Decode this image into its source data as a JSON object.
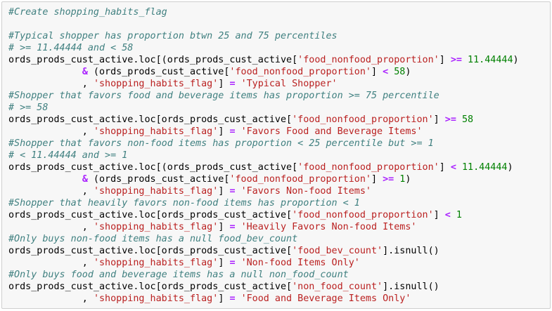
{
  "cell": {
    "language": "python",
    "lines": [
      [
        {
          "t": "com",
          "v": "#Create shopping_habits_flag"
        }
      ],
      [],
      [
        {
          "t": "com",
          "v": "#Typical shopper has proportion btwn 25 and 75 percentiles"
        }
      ],
      [
        {
          "t": "com",
          "v": "# >= 11.44444 and < 58"
        }
      ],
      [
        {
          "t": "p",
          "v": "ords_prods_cust_active.loc[(ords_prods_cust_active["
        },
        {
          "t": "str",
          "v": "'food_nonfood_proportion'"
        },
        {
          "t": "p",
          "v": "] "
        },
        {
          "t": "op",
          "v": ">="
        },
        {
          "t": "p",
          "v": " "
        },
        {
          "t": "num",
          "v": "11.44444"
        },
        {
          "t": "p",
          "v": ")"
        }
      ],
      [
        {
          "t": "p",
          "v": "             "
        },
        {
          "t": "op",
          "v": "&"
        },
        {
          "t": "p",
          "v": " (ords_prods_cust_active["
        },
        {
          "t": "str",
          "v": "'food_nonfood_proportion'"
        },
        {
          "t": "p",
          "v": "] "
        },
        {
          "t": "op",
          "v": "<"
        },
        {
          "t": "p",
          "v": " "
        },
        {
          "t": "num",
          "v": "58"
        },
        {
          "t": "p",
          "v": ")"
        }
      ],
      [
        {
          "t": "p",
          "v": "             , "
        },
        {
          "t": "str",
          "v": "'shopping_habits_flag'"
        },
        {
          "t": "p",
          "v": "] "
        },
        {
          "t": "op",
          "v": "="
        },
        {
          "t": "p",
          "v": " "
        },
        {
          "t": "str",
          "v": "'Typical Shopper'"
        }
      ],
      [
        {
          "t": "com",
          "v": "#Shopper that favors food and beverage items has proportion >= 75 percentile"
        }
      ],
      [
        {
          "t": "com",
          "v": "# >= 58"
        }
      ],
      [
        {
          "t": "p",
          "v": "ords_prods_cust_active.loc[ords_prods_cust_active["
        },
        {
          "t": "str",
          "v": "'food_nonfood_proportion'"
        },
        {
          "t": "p",
          "v": "] "
        },
        {
          "t": "op",
          "v": ">="
        },
        {
          "t": "p",
          "v": " "
        },
        {
          "t": "num",
          "v": "58"
        }
      ],
      [
        {
          "t": "p",
          "v": "             , "
        },
        {
          "t": "str",
          "v": "'shopping_habits_flag'"
        },
        {
          "t": "p",
          "v": "] "
        },
        {
          "t": "op",
          "v": "="
        },
        {
          "t": "p",
          "v": " "
        },
        {
          "t": "str",
          "v": "'Favors Food and Beverage Items'"
        }
      ],
      [
        {
          "t": "com",
          "v": "#Shopper that favors non-food items has proportion < 25 percentile but >= 1"
        }
      ],
      [
        {
          "t": "com",
          "v": "# < 11.44444 and >= 1"
        }
      ],
      [
        {
          "t": "p",
          "v": "ords_prods_cust_active.loc[(ords_prods_cust_active["
        },
        {
          "t": "str",
          "v": "'food_nonfood_proportion'"
        },
        {
          "t": "p",
          "v": "] "
        },
        {
          "t": "op",
          "v": "<"
        },
        {
          "t": "p",
          "v": " "
        },
        {
          "t": "num",
          "v": "11.44444"
        },
        {
          "t": "p",
          "v": ")"
        }
      ],
      [
        {
          "t": "p",
          "v": "             "
        },
        {
          "t": "op",
          "v": "&"
        },
        {
          "t": "p",
          "v": " (ords_prods_cust_active["
        },
        {
          "t": "str",
          "v": "'food_nonfood_proportion'"
        },
        {
          "t": "p",
          "v": "] "
        },
        {
          "t": "op",
          "v": ">="
        },
        {
          "t": "p",
          "v": " "
        },
        {
          "t": "num",
          "v": "1"
        },
        {
          "t": "p",
          "v": ")"
        }
      ],
      [
        {
          "t": "p",
          "v": "             , "
        },
        {
          "t": "str",
          "v": "'shopping_habits_flag'"
        },
        {
          "t": "p",
          "v": "] "
        },
        {
          "t": "op",
          "v": "="
        },
        {
          "t": "p",
          "v": " "
        },
        {
          "t": "str",
          "v": "'Favors Non-food Items'"
        }
      ],
      [
        {
          "t": "com",
          "v": "#Shopper that heavily favors non-food items has proportion < 1"
        }
      ],
      [
        {
          "t": "p",
          "v": "ords_prods_cust_active.loc[ords_prods_cust_active["
        },
        {
          "t": "str",
          "v": "'food_nonfood_proportion'"
        },
        {
          "t": "p",
          "v": "] "
        },
        {
          "t": "op",
          "v": "<"
        },
        {
          "t": "p",
          "v": " "
        },
        {
          "t": "num",
          "v": "1"
        }
      ],
      [
        {
          "t": "p",
          "v": "             , "
        },
        {
          "t": "str",
          "v": "'shopping_habits_flag'"
        },
        {
          "t": "p",
          "v": "] "
        },
        {
          "t": "op",
          "v": "="
        },
        {
          "t": "p",
          "v": " "
        },
        {
          "t": "str",
          "v": "'Heavily Favors Non-food Items'"
        }
      ],
      [
        {
          "t": "com",
          "v": "#Only buys non-food items has a null food_bev_count"
        }
      ],
      [
        {
          "t": "p",
          "v": "ords_prods_cust_active.loc[ords_prods_cust_active["
        },
        {
          "t": "str",
          "v": "'food_bev_count'"
        },
        {
          "t": "p",
          "v": "].isnull()"
        }
      ],
      [
        {
          "t": "p",
          "v": "             , "
        },
        {
          "t": "str",
          "v": "'shopping_habits_flag'"
        },
        {
          "t": "p",
          "v": "] "
        },
        {
          "t": "op",
          "v": "="
        },
        {
          "t": "p",
          "v": " "
        },
        {
          "t": "str",
          "v": "'Non-food Items Only'"
        }
      ],
      [
        {
          "t": "com",
          "v": "#Only buys food and beverage items has a null non_food_count"
        }
      ],
      [
        {
          "t": "p",
          "v": "ords_prods_cust_active.loc[ords_prods_cust_active["
        },
        {
          "t": "str",
          "v": "'non_food_count'"
        },
        {
          "t": "p",
          "v": "].isnull()"
        }
      ],
      [
        {
          "t": "p",
          "v": "             , "
        },
        {
          "t": "str",
          "v": "'shopping_habits_flag'"
        },
        {
          "t": "p",
          "v": "] "
        },
        {
          "t": "op",
          "v": "="
        },
        {
          "t": "p",
          "v": " "
        },
        {
          "t": "str",
          "v": "'Food and Beverage Items Only'"
        }
      ]
    ]
  },
  "colors": {
    "comment": "#408080",
    "string": "#ba2121",
    "operator": "#aa22ff",
    "number": "#008000",
    "plain": "#000000",
    "cell_background": "#f7f7f7",
    "cell_border": "#cfcfcf"
  }
}
